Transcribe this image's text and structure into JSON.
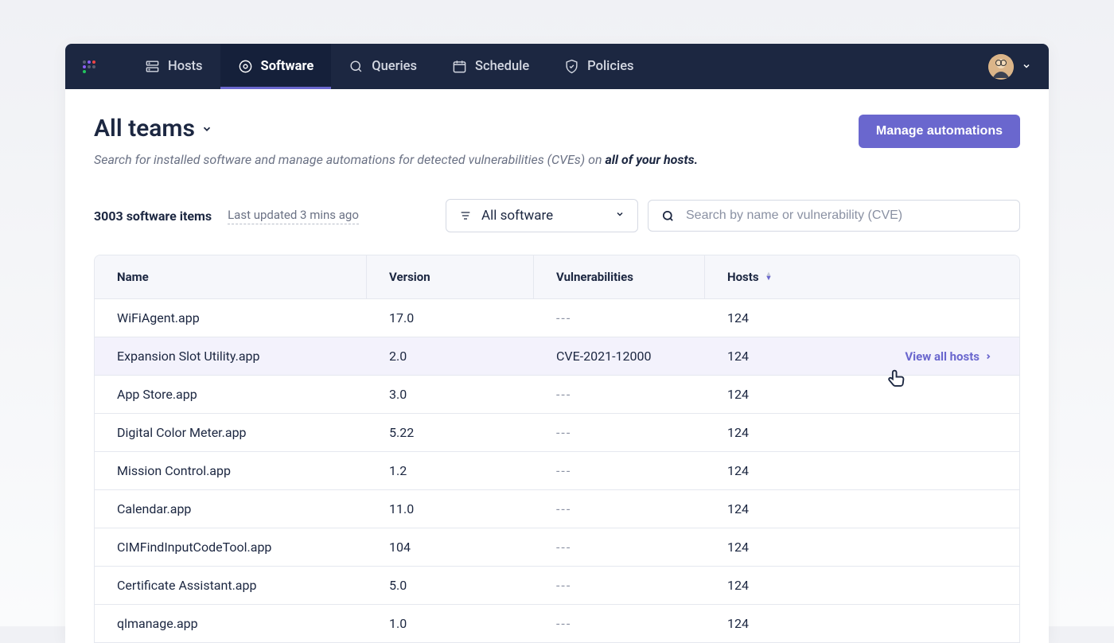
{
  "nav": {
    "items": [
      {
        "label": "Hosts"
      },
      {
        "label": "Software"
      },
      {
        "label": "Queries"
      },
      {
        "label": "Schedule"
      },
      {
        "label": "Policies"
      }
    ]
  },
  "header": {
    "team_select": "All teams",
    "subtitle_prefix": "Search for installed software and manage automations for detected vulnerabilities (CVEs) on ",
    "subtitle_bold": "all of your hosts.",
    "manage_button": "Manage automations"
  },
  "controls": {
    "count_label": "3003 software items",
    "last_updated": "Last updated 3 mins ago",
    "filter_label": "All software",
    "search_placeholder": "Search by name or vulnerability (CVE)"
  },
  "table": {
    "columns": [
      "Name",
      "Version",
      "Vulnerabilities",
      "Hosts"
    ],
    "view_all_label": "View all hosts",
    "rows": [
      {
        "name": "WiFiAgent.app",
        "version": "17.0",
        "vuln": "---",
        "hosts": "124"
      },
      {
        "name": "Expansion Slot Utility.app",
        "version": "2.0",
        "vuln": "CVE-2021-12000",
        "hosts": "124",
        "highlight": true
      },
      {
        "name": "App Store.app",
        "version": "3.0",
        "vuln": "---",
        "hosts": "124"
      },
      {
        "name": "Digital Color Meter.app",
        "version": "5.22",
        "vuln": "---",
        "hosts": "124"
      },
      {
        "name": "Mission Control.app",
        "version": "1.2",
        "vuln": "---",
        "hosts": "124"
      },
      {
        "name": "Calendar.app",
        "version": "11.0",
        "vuln": "---",
        "hosts": "124"
      },
      {
        "name": "CIMFindInputCodeTool.app",
        "version": "104",
        "vuln": "---",
        "hosts": "124"
      },
      {
        "name": "Certificate Assistant.app",
        "version": "5.0",
        "vuln": "---",
        "hosts": "124"
      },
      {
        "name": "qlmanage.app",
        "version": "1.0",
        "vuln": "---",
        "hosts": "124"
      }
    ]
  }
}
